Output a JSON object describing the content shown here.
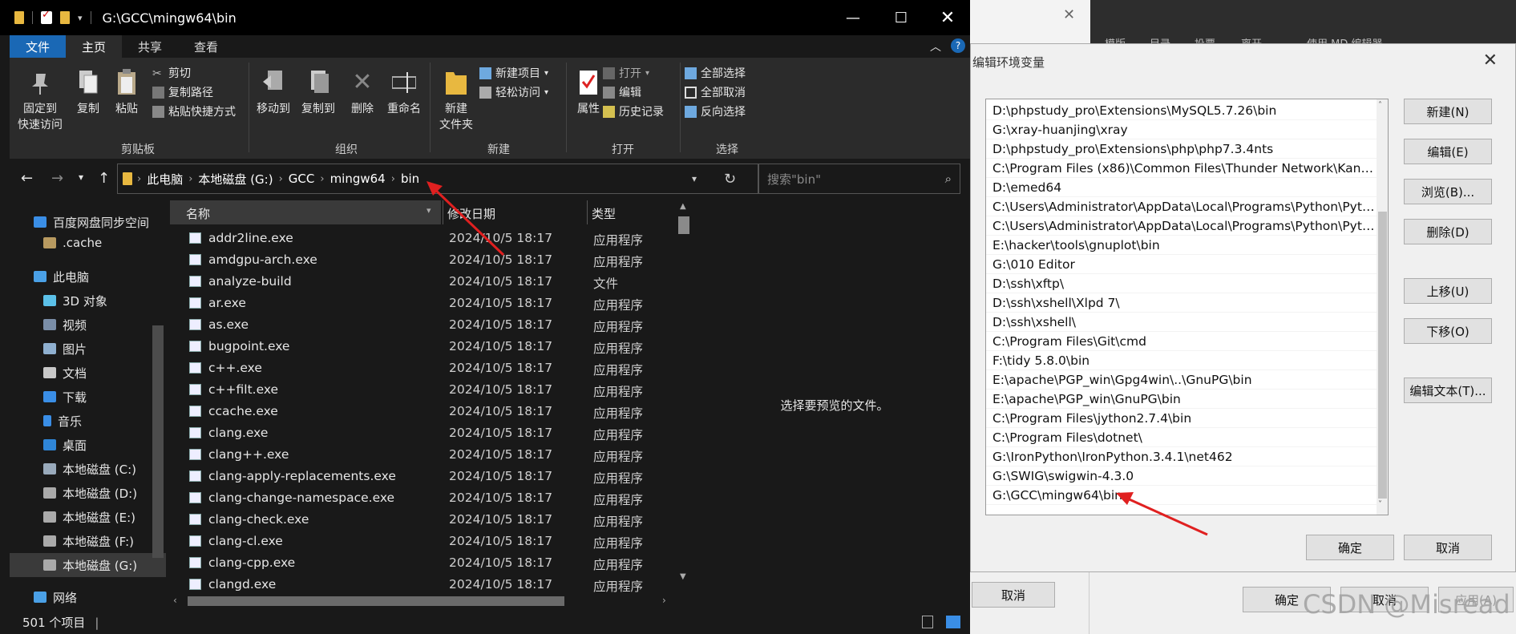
{
  "explorer": {
    "title": "G:\\GCC\\mingw64\\bin",
    "tabs": [
      "文件",
      "主页",
      "共享",
      "查看"
    ],
    "ribbon": {
      "pin_label": "固定到\n快速访问",
      "copy_label": "复制",
      "paste_label": "粘贴",
      "cut_label": "剪切",
      "copy_path_label": "复制路径",
      "paste_shortcut_label": "粘贴快捷方式",
      "clipboard_group": "剪贴板",
      "move_to_label": "移动到",
      "copy_to_label": "复制到",
      "delete_label": "删除",
      "rename_label": "重命名",
      "organize_group": "组织",
      "new_folder_label": "新建\n文件夹",
      "new_item_label": "新建项目",
      "easy_access_label": "轻松访问",
      "new_group": "新建",
      "properties_label": "属性",
      "open_label": "打开",
      "edit_label": "编辑",
      "history_label": "历史记录",
      "open_group": "打开",
      "select_all_label": "全部选择",
      "select_none_label": "全部取消",
      "invert_selection_label": "反向选择",
      "select_group": "选择"
    },
    "breadcrumb": [
      "此电脑",
      "本地磁盘 (G:)",
      "GCC",
      "mingw64",
      "bin"
    ],
    "search_placeholder": "搜索\"bin\"",
    "nav_items": [
      {
        "label": "百度网盘同步空间",
        "icon": "baidu-cloud-icon"
      },
      {
        "label": ".cache",
        "icon": "folder-icon"
      },
      {
        "label": "此电脑",
        "icon": "computer-icon"
      },
      {
        "label": "3D 对象",
        "icon": "cube-icon"
      },
      {
        "label": "视频",
        "icon": "video-icon"
      },
      {
        "label": "图片",
        "icon": "picture-icon"
      },
      {
        "label": "文档",
        "icon": "document-icon"
      },
      {
        "label": "下载",
        "icon": "download-icon"
      },
      {
        "label": "音乐",
        "icon": "music-icon"
      },
      {
        "label": "桌面",
        "icon": "desktop-icon"
      },
      {
        "label": "本地磁盘 (C:)",
        "icon": "drive-icon"
      },
      {
        "label": "本地磁盘 (D:)",
        "icon": "drive-icon"
      },
      {
        "label": "本地磁盘 (E:)",
        "icon": "drive-icon"
      },
      {
        "label": "本地磁盘 (F:)",
        "icon": "drive-icon"
      },
      {
        "label": "本地磁盘 (G:)",
        "icon": "drive-icon"
      },
      {
        "label": "网络",
        "icon": "network-icon"
      }
    ],
    "columns": {
      "name": "名称",
      "modified": "修改日期",
      "type": "类型"
    },
    "files": [
      {
        "name": "addr2line.exe",
        "date": "2024/10/5 18:17",
        "type": "应用程序"
      },
      {
        "name": "amdgpu-arch.exe",
        "date": "2024/10/5 18:17",
        "type": "应用程序"
      },
      {
        "name": "analyze-build",
        "date": "2024/10/5 18:17",
        "type": "文件"
      },
      {
        "name": "ar.exe",
        "date": "2024/10/5 18:17",
        "type": "应用程序"
      },
      {
        "name": "as.exe",
        "date": "2024/10/5 18:17",
        "type": "应用程序"
      },
      {
        "name": "bugpoint.exe",
        "date": "2024/10/5 18:17",
        "type": "应用程序"
      },
      {
        "name": "c++.exe",
        "date": "2024/10/5 18:17",
        "type": "应用程序"
      },
      {
        "name": "c++filt.exe",
        "date": "2024/10/5 18:17",
        "type": "应用程序"
      },
      {
        "name": "ccache.exe",
        "date": "2024/10/5 18:17",
        "type": "应用程序"
      },
      {
        "name": "clang.exe",
        "date": "2024/10/5 18:17",
        "type": "应用程序"
      },
      {
        "name": "clang++.exe",
        "date": "2024/10/5 18:17",
        "type": "应用程序"
      },
      {
        "name": "clang-apply-replacements.exe",
        "date": "2024/10/5 18:17",
        "type": "应用程序"
      },
      {
        "name": "clang-change-namespace.exe",
        "date": "2024/10/5 18:17",
        "type": "应用程序"
      },
      {
        "name": "clang-check.exe",
        "date": "2024/10/5 18:17",
        "type": "应用程序"
      },
      {
        "name": "clang-cl.exe",
        "date": "2024/10/5 18:17",
        "type": "应用程序"
      },
      {
        "name": "clang-cpp.exe",
        "date": "2024/10/5 18:17",
        "type": "应用程序"
      },
      {
        "name": "clangd.exe",
        "date": "2024/10/5 18:17",
        "type": "应用程序"
      }
    ],
    "preview_text": "选择要预览的文件。",
    "status_text": "501 个项目"
  },
  "dialog": {
    "title": "编辑环境变量",
    "paths": [
      "D:\\phpstudy_pro\\Extensions\\MySQL5.7.26\\bin",
      "G:\\xray-huanjing\\xray",
      "D:\\phpstudy_pro\\Extensions\\php\\php7.3.4nts",
      "C:\\Program Files (x86)\\Common Files\\Thunder Network\\KanKa...",
      "D:\\emed64",
      "C:\\Users\\Administrator\\AppData\\Local\\Programs\\Python\\Pyth...",
      "C:\\Users\\Administrator\\AppData\\Local\\Programs\\Python\\Pyth...",
      "E:\\hacker\\tools\\gnuplot\\bin",
      "G:\\010 Editor",
      "D:\\ssh\\xftp\\",
      "D:\\ssh\\xshell\\Xlpd 7\\",
      "D:\\ssh\\xshell\\",
      "C:\\Program Files\\Git\\cmd",
      "F:\\tidy 5.8.0\\bin",
      "E:\\apache\\PGP_win\\Gpg4win\\..\\GnuPG\\bin",
      "E:\\apache\\PGP_win\\GnuPG\\bin",
      "C:\\Program Files\\jython2.7.4\\bin",
      "C:\\Program Files\\dotnet\\",
      "G:\\IronPython\\IronPython.3.4.1\\net462",
      "G:\\SWIG\\swigwin-4.3.0",
      "G:\\GCC\\mingw64\\bin"
    ],
    "buttons": {
      "new": "新建(N)",
      "edit": "编辑(E)",
      "browse": "浏览(B)...",
      "delete": "删除(D)",
      "move_up": "上移(U)",
      "move_down": "下移(O)",
      "edit_text": "编辑文本(T)...",
      "ok": "确定",
      "cancel": "取消"
    }
  },
  "background": {
    "top_toolbar": [
      "模版",
      "目录",
      "投票",
      "离开",
      "使用 MD 编辑器"
    ],
    "bottom_cancel_left": "取消",
    "bottom_ok": "确定",
    "bottom_cancel": "取消",
    "bottom_apply": "应用(A)"
  },
  "watermark": "CSDN @Misread",
  "colors": {
    "accent": "#1a68b5",
    "arrow": "#e02020",
    "folder": "#e8b840"
  }
}
